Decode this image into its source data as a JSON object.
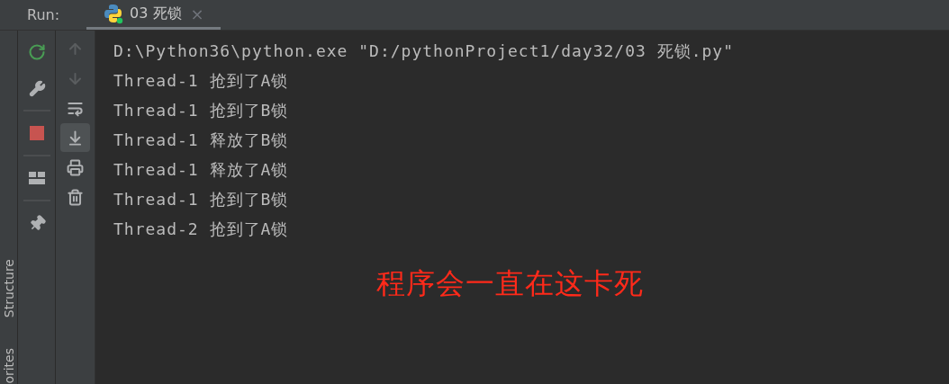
{
  "run_bar": {
    "label": "Run:",
    "tabs": [
      {
        "title": "03 死锁",
        "selected": true,
        "close": "×"
      }
    ]
  },
  "side_tabs": [
    {
      "label": "Structure"
    },
    {
      "label": "orites"
    }
  ],
  "action_toolbar": [
    {
      "kind": "rerun"
    },
    {
      "kind": "settings"
    },
    {
      "kind": "divider"
    },
    {
      "kind": "stop"
    },
    {
      "kind": "divider"
    },
    {
      "kind": "layout"
    },
    {
      "kind": "divider"
    },
    {
      "kind": "pin"
    }
  ],
  "console_toolbar": [
    {
      "kind": "up",
      "disabled": true,
      "selected": false
    },
    {
      "kind": "down",
      "disabled": true,
      "selected": false
    },
    {
      "kind": "wrap",
      "disabled": false,
      "selected": false
    },
    {
      "kind": "scroll-end",
      "disabled": false,
      "selected": true
    },
    {
      "kind": "print",
      "disabled": false,
      "selected": false
    },
    {
      "kind": "trash",
      "disabled": false,
      "selected": false
    }
  ],
  "console": {
    "lines": [
      "D:\\Python36\\python.exe \"D:/pythonProject1/day32/03 死锁.py\"",
      "Thread-1 抢到了A锁",
      "Thread-1 抢到了B锁",
      "Thread-1 释放了B锁",
      "Thread-1 释放了A锁",
      "Thread-1 抢到了B锁",
      "Thread-2 抢到了A锁"
    ],
    "annotation": "程序会一直在这卡死"
  }
}
